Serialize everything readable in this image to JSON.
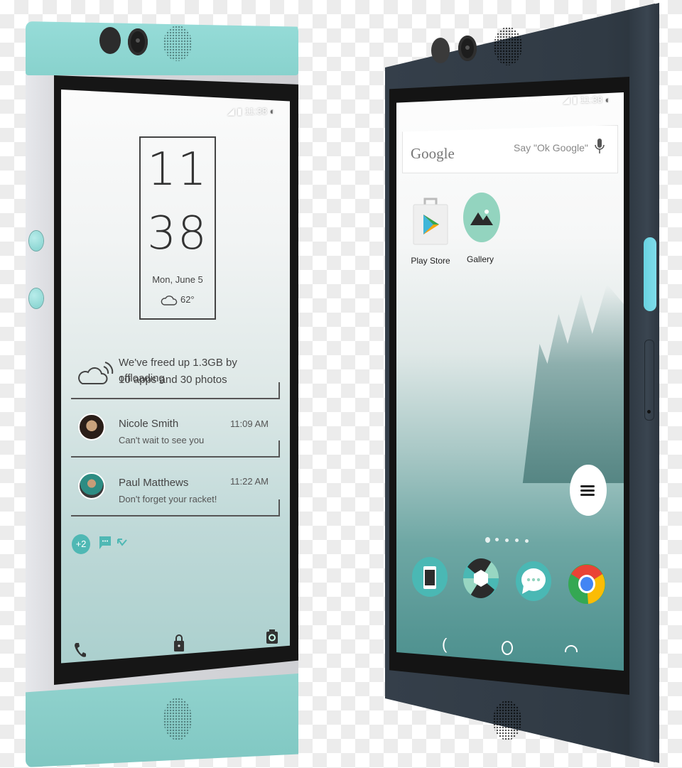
{
  "left_phone": {
    "color_name": "mint",
    "status_bar": {
      "time": "11:38"
    },
    "clock_widget": {
      "hour": "11",
      "minute": "38",
      "date": "Mon, June 5",
      "weather_icon": "cloud-icon",
      "temperature": "62°"
    },
    "notifications": [
      {
        "type": "system",
        "icon": "cloud-sync-icon",
        "text_line1": "We've freed up 1.3GB by offloading",
        "text_line2": "10 apps and 30 photos"
      },
      {
        "type": "message",
        "name": "Nicole Smith",
        "time": "11:09 AM",
        "message": "Can't wait to see you"
      },
      {
        "type": "message",
        "name": "Paul Matthews",
        "time": "11:22 AM",
        "message": "Don't forget your racket!"
      }
    ],
    "overflow_badge": "+2",
    "bottom_shortcuts": [
      "phone-icon",
      "lock-icon",
      "camera-icon"
    ]
  },
  "right_phone": {
    "color_name": "midnight blue",
    "status_bar": {
      "time": "11:38"
    },
    "search": {
      "logo": "Google",
      "hint": "Say \"Ok Google\""
    },
    "apps": [
      {
        "label": "Play Store",
        "icon": "play-store-icon"
      },
      {
        "label": "Gallery",
        "icon": "gallery-icon"
      }
    ],
    "page_indicator": {
      "pages": 5,
      "current": 1
    },
    "dock": [
      {
        "name": "phone",
        "icon": "phone-app-icon"
      },
      {
        "name": "camera",
        "icon": "shutter-icon"
      },
      {
        "name": "messenger",
        "icon": "chat-icon"
      },
      {
        "name": "chrome",
        "icon": "chrome-icon"
      }
    ],
    "nav": [
      "back",
      "home",
      "recents"
    ],
    "colors": {
      "accent_button": "#69d2e0",
      "body": "#343e49"
    }
  },
  "colors": {
    "mint_accent": "#88d2cd",
    "notification_badge": "#4fb8b4"
  }
}
